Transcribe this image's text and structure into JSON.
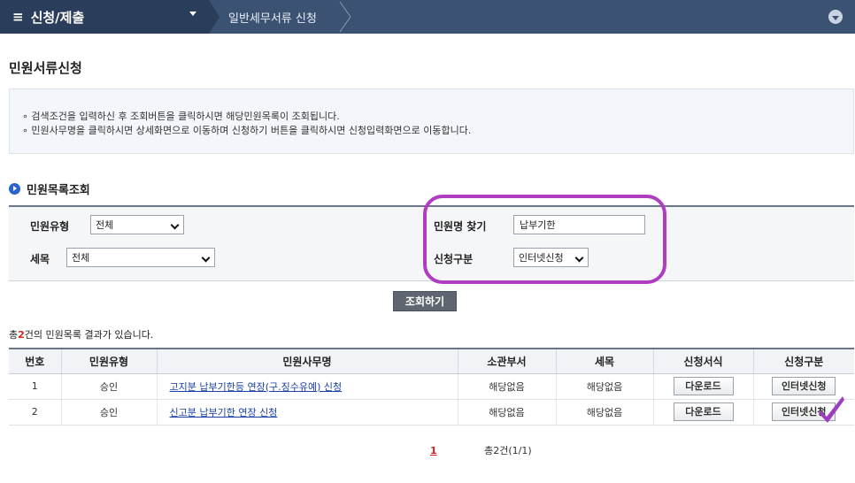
{
  "topbar": {
    "menu_label": "신청/제출",
    "breadcrumb": "일반세무서류 신청"
  },
  "page_title": "민원서류신청",
  "info": {
    "line1": "∘ 검색조건을 입력하신 후 조회버튼을 클릭하시면 해당민원목록이 조회됩니다.",
    "line2": "∘ 민원사무명을 클릭하시면 상세화면으로 이동하며  신청하기 버튼을 클릭하시면 신청입력화면으로 이동합니다."
  },
  "section_title": "민원목록조회",
  "search": {
    "type_label": "민원유형",
    "type_value": "전체",
    "tax_label": "세목",
    "tax_value": "전체",
    "name_label": "민원명 찾기",
    "name_value": "납부기한",
    "method_label": "신청구분",
    "method_value": "인터넷신청",
    "button_label": "조회하기"
  },
  "result": {
    "prefix": "총",
    "count": "2",
    "suffix": "건의 민원목록 결과가 있습니다."
  },
  "table": {
    "headers": [
      "번호",
      "민원유형",
      "민원사무명",
      "소관부서",
      "세목",
      "신청서식",
      "신청구분"
    ],
    "rows": [
      {
        "no": "1",
        "type": "승인",
        "name": "고지분 납부기한등 연장(구.징수유예) 신청",
        "dept": "해당없음",
        "tax": "해당없음",
        "form": "다운로드",
        "apply": "인터넷신청"
      },
      {
        "no": "2",
        "type": "승인",
        "name": "신고분 납부기한 연장 신청",
        "dept": "해당없음",
        "tax": "해당없음",
        "form": "다운로드",
        "apply": "인터넷신청"
      }
    ]
  },
  "pager": {
    "current": "1",
    "summary": "총2건(1/1)"
  },
  "colors": {
    "topbar": "#3b5272",
    "highlight": "#b03cc0",
    "check": "#9b3fc0",
    "link": "#1a3fa8"
  }
}
